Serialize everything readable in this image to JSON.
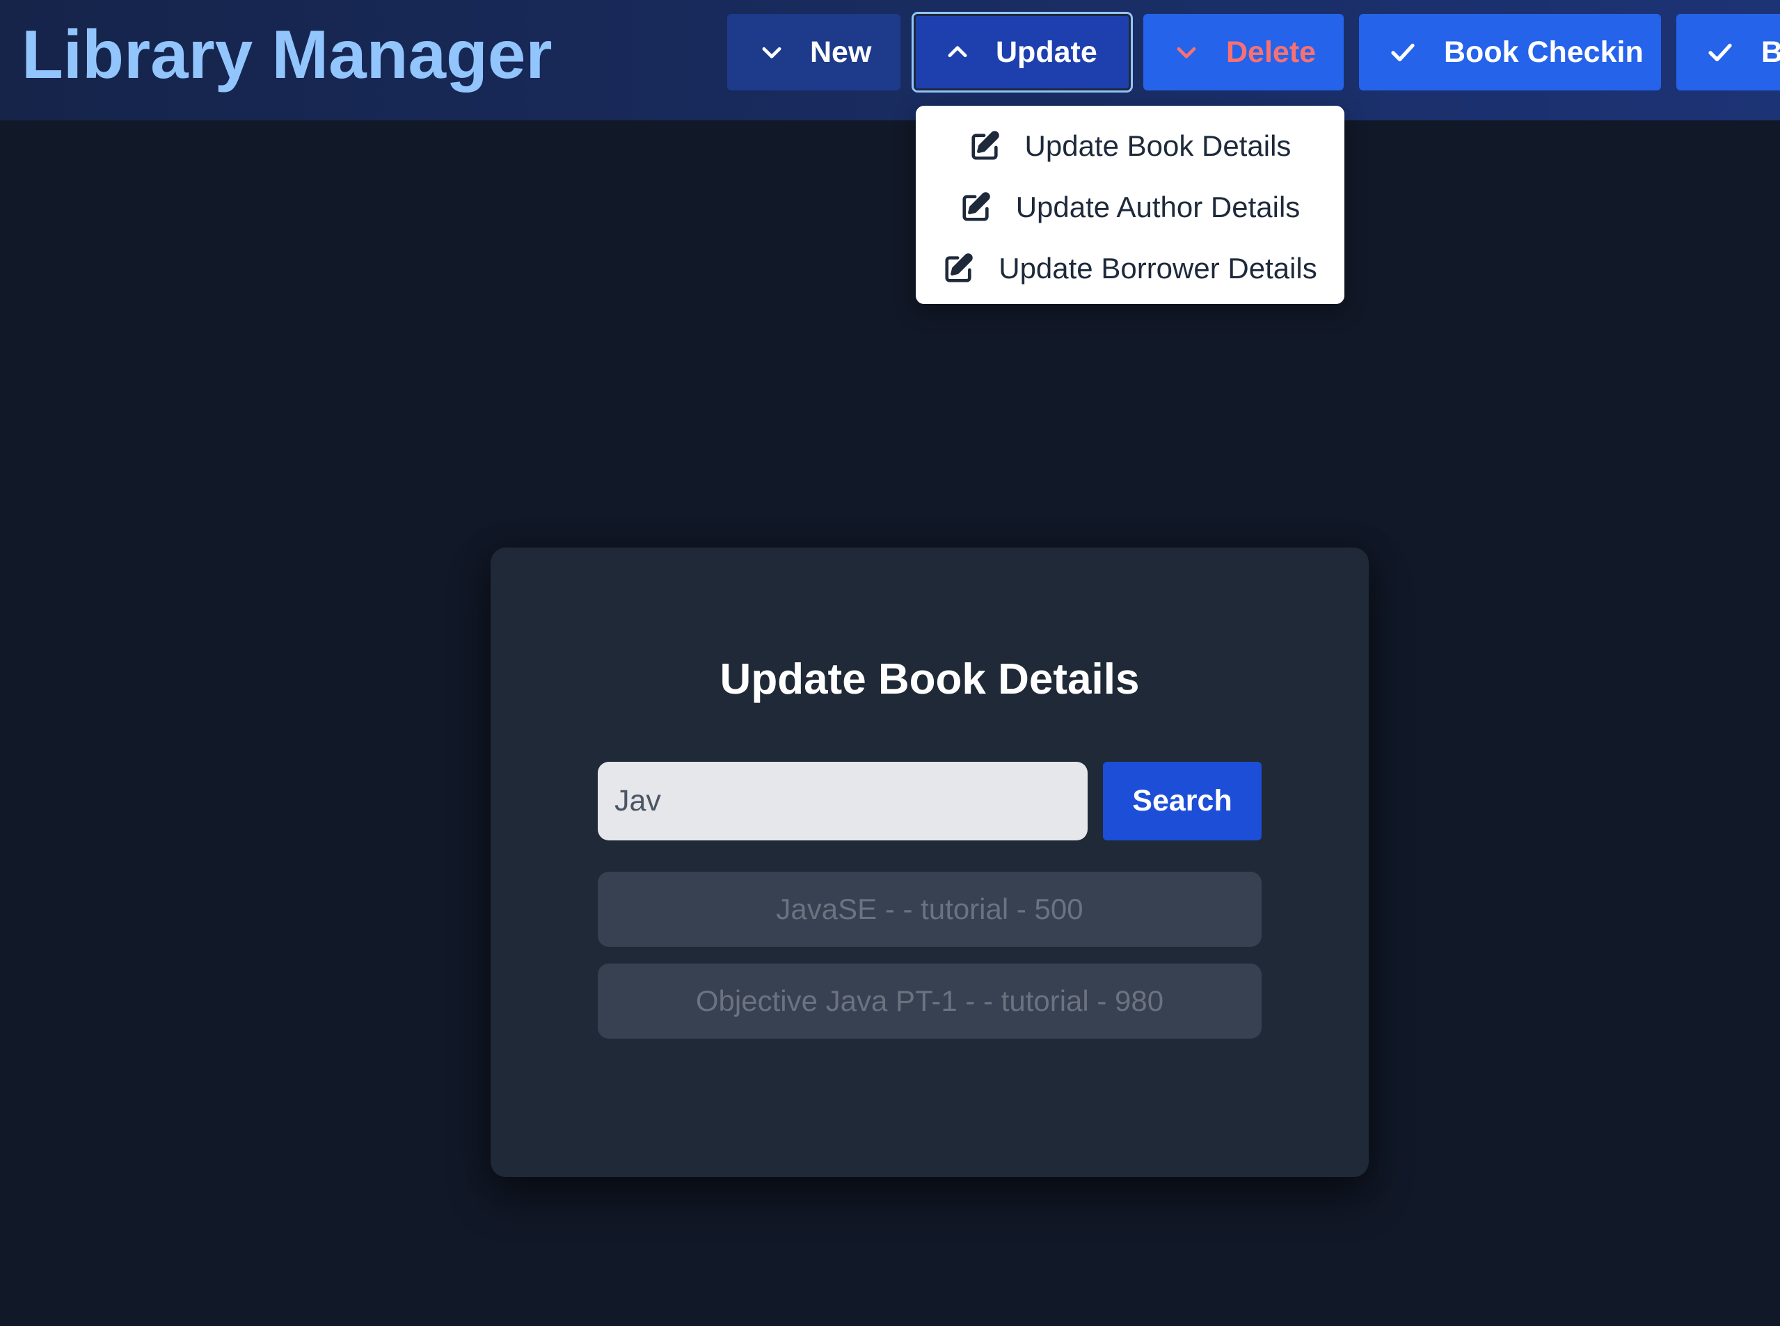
{
  "header": {
    "title": "Library Manager",
    "accent_color": "#93c5fd",
    "background_color": "#1c3375"
  },
  "nav": {
    "new": {
      "label": "New",
      "icon": "chevron-down-icon"
    },
    "update": {
      "label": "Update",
      "icon": "chevron-up-icon",
      "state": "open"
    },
    "delete": {
      "label": "Delete",
      "icon": "chevron-down-icon",
      "label_color": "#f87171"
    },
    "checkin": {
      "label": "Book Checkin",
      "icon": "check-icon"
    },
    "checkout": {
      "label": "Bo",
      "icon": "check-icon"
    }
  },
  "dropdown": {
    "items": [
      {
        "label": "Update Book Details",
        "icon": "edit-icon"
      },
      {
        "label": "Update Author Details",
        "icon": "edit-icon"
      },
      {
        "label": "Update Borrower Details",
        "icon": "edit-icon"
      }
    ]
  },
  "main": {
    "title": "Update Book Details",
    "search": {
      "value": "Jav",
      "button_label": "Search"
    },
    "results": [
      {
        "text": "JavaSE - - tutorial - 500"
      },
      {
        "text": "Objective Java PT-1 - - tutorial - 980"
      }
    ]
  }
}
